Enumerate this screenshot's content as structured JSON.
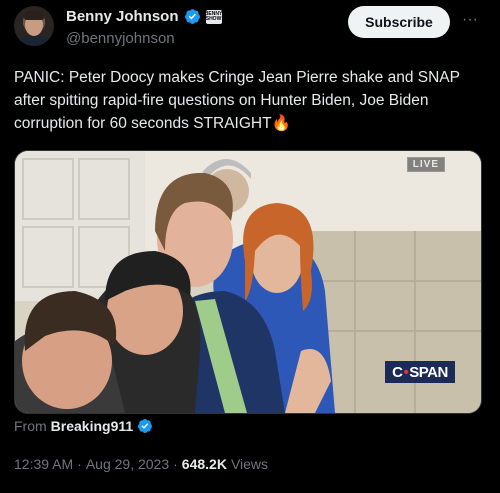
{
  "author": {
    "name": "Benny Johnson",
    "handle": "@bennyjohnson",
    "affiliate_badge": "BENNY SHOW"
  },
  "actions": {
    "subscribe_label": "Subscribe",
    "more_label": "···"
  },
  "tweet": {
    "text": "PANIC: Peter Doocy makes Cringe Jean Pierre shake and SNAP after spitting rapid-fire questions on Hunter Biden, Joe Biden corruption for 60 seconds STRAIGHT🔥"
  },
  "media": {
    "live_badge": "LIVE",
    "network_logo_left": "C",
    "network_logo_dot": "•",
    "network_logo_right": "SPAN"
  },
  "source": {
    "from_label": "From",
    "name": "Breaking911"
  },
  "meta": {
    "time": "12:39 AM",
    "separator": "·",
    "date": "Aug 29, 2023",
    "separator2": "·",
    "views_count": "648.2K",
    "views_label": "Views"
  },
  "colors": {
    "verified": "#1d9bf0",
    "text": "#e7e9ea",
    "muted": "#71767b"
  }
}
